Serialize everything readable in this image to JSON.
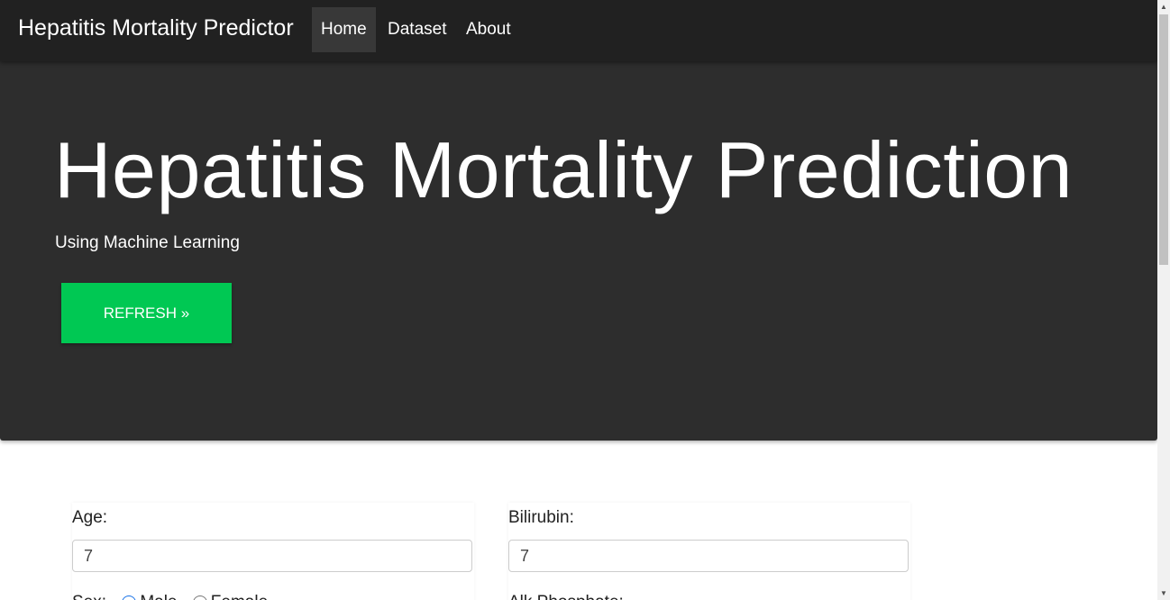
{
  "navbar": {
    "brand": "Hepatitis Mortality Predictor",
    "items": [
      {
        "label": "Home",
        "active": true
      },
      {
        "label": "Dataset"
      },
      {
        "label": "About"
      }
    ]
  },
  "hero": {
    "title": "Hepatitis Mortality Prediction",
    "subtitle": "Using Machine Learning",
    "button": "REFRESH »",
    "button_color": "#00c853"
  },
  "form": {
    "age": {
      "label": "Age:",
      "value": "7"
    },
    "bilirubin": {
      "label": "Bilirubin:",
      "value": "7"
    },
    "sex": {
      "label": "Sex:",
      "options": [
        "Male",
        "Female"
      ],
      "selected": "Male"
    },
    "alk_phosphate": {
      "label": "Alk Phosphate:"
    }
  }
}
